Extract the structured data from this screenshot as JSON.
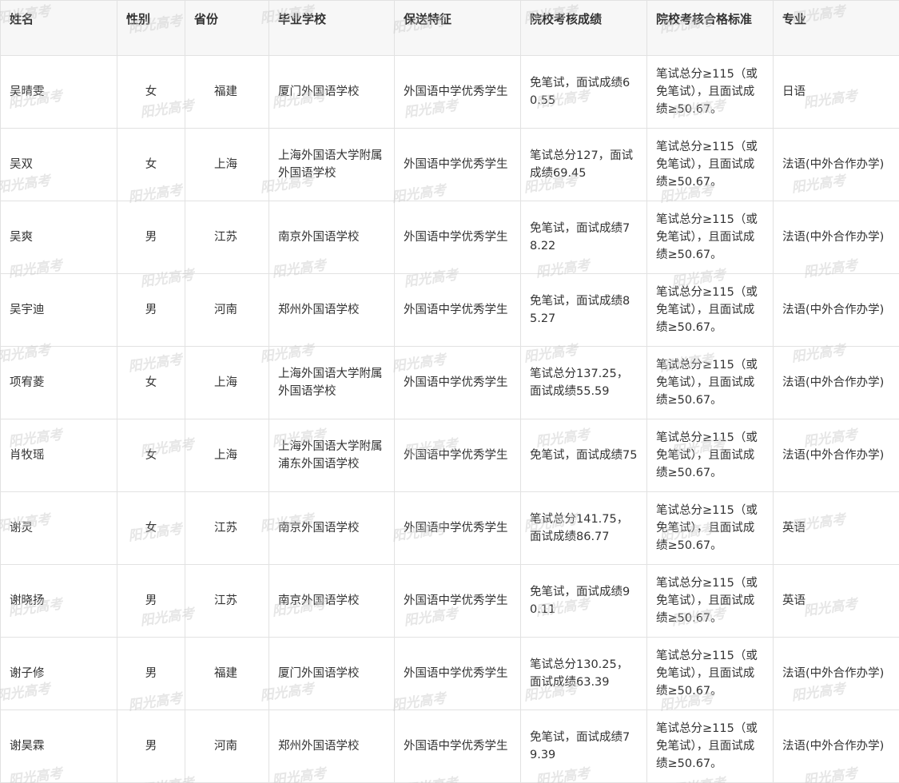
{
  "table": {
    "headers": {
      "name": "姓名",
      "gender": "性别",
      "province": "省份",
      "school": "毕业学校",
      "feature": "保送特征",
      "score": "院校考核成绩",
      "standard": "院校考核合格标准",
      "major": "专业"
    },
    "rows": [
      {
        "name": "吴晴雯",
        "gender": "女",
        "province": "福建",
        "school": "厦门外国语学校",
        "feature": "外国语中学优秀学生",
        "score": "免笔试，面试成绩60.55",
        "standard": "笔试总分≥115（或免笔试），且面试成绩≥50.67。",
        "major": "日语"
      },
      {
        "name": "吴双",
        "gender": "女",
        "province": "上海",
        "school": "上海外国语大学附属外国语学校",
        "feature": "外国语中学优秀学生",
        "score": "笔试总分127，面试成绩69.45",
        "standard": "笔试总分≥115（或免笔试），且面试成绩≥50.67。",
        "major": "法语(中外合作办学)"
      },
      {
        "name": "吴爽",
        "gender": "男",
        "province": "江苏",
        "school": "南京外国语学校",
        "feature": "外国语中学优秀学生",
        "score": "免笔试，面试成绩78.22",
        "standard": "笔试总分≥115（或免笔试），且面试成绩≥50.67。",
        "major": "法语(中外合作办学)"
      },
      {
        "name": "吴宇迪",
        "gender": "男",
        "province": "河南",
        "school": "郑州外国语学校",
        "feature": "外国语中学优秀学生",
        "score": "免笔试，面试成绩85.27",
        "standard": "笔试总分≥115（或免笔试），且面试成绩≥50.67。",
        "major": "法语(中外合作办学)"
      },
      {
        "name": "项宥菱",
        "gender": "女",
        "province": "上海",
        "school": "上海外国语大学附属外国语学校",
        "feature": "外国语中学优秀学生",
        "score": "笔试总分137.25，面试成绩55.59",
        "standard": "笔试总分≥115（或免笔试），且面试成绩≥50.67。",
        "major": "法语(中外合作办学)"
      },
      {
        "name": "肖牧瑶",
        "gender": "女",
        "province": "上海",
        "school": "上海外国语大学附属浦东外国语学校",
        "feature": "外国语中学优秀学生",
        "score": "免笔试，面试成绩75",
        "standard": "笔试总分≥115（或免笔试），且面试成绩≥50.67。",
        "major": "法语(中外合作办学)"
      },
      {
        "name": "谢灵",
        "gender": "女",
        "province": "江苏",
        "school": "南京外国语学校",
        "feature": "外国语中学优秀学生",
        "score": "笔试总分141.75，面试成绩86.77",
        "standard": "笔试总分≥115（或免笔试），且面试成绩≥50.67。",
        "major": "英语"
      },
      {
        "name": "谢晓扬",
        "gender": "男",
        "province": "江苏",
        "school": "南京外国语学校",
        "feature": "外国语中学优秀学生",
        "score": "免笔试，面试成绩90.11",
        "standard": "笔试总分≥115（或免笔试），且面试成绩≥50.67。",
        "major": "英语"
      },
      {
        "name": "谢子修",
        "gender": "男",
        "province": "福建",
        "school": "厦门外国语学校",
        "feature": "外国语中学优秀学生",
        "score": "笔试总分130.25，面试成绩63.39",
        "standard": "笔试总分≥115（或免笔试），且面试成绩≥50.67。",
        "major": "法语(中外合作办学)"
      },
      {
        "name": "谢昊霖",
        "gender": "男",
        "province": "河南",
        "school": "郑州外国语学校",
        "feature": "外国语中学优秀学生",
        "score": "免笔试，面试成绩79.39",
        "standard": "笔试总分≥115（或免笔试），且面试成绩≥50.67。",
        "major": "法语(中外合作办学)"
      }
    ]
  },
  "watermark": {
    "text": "阳光高考"
  }
}
